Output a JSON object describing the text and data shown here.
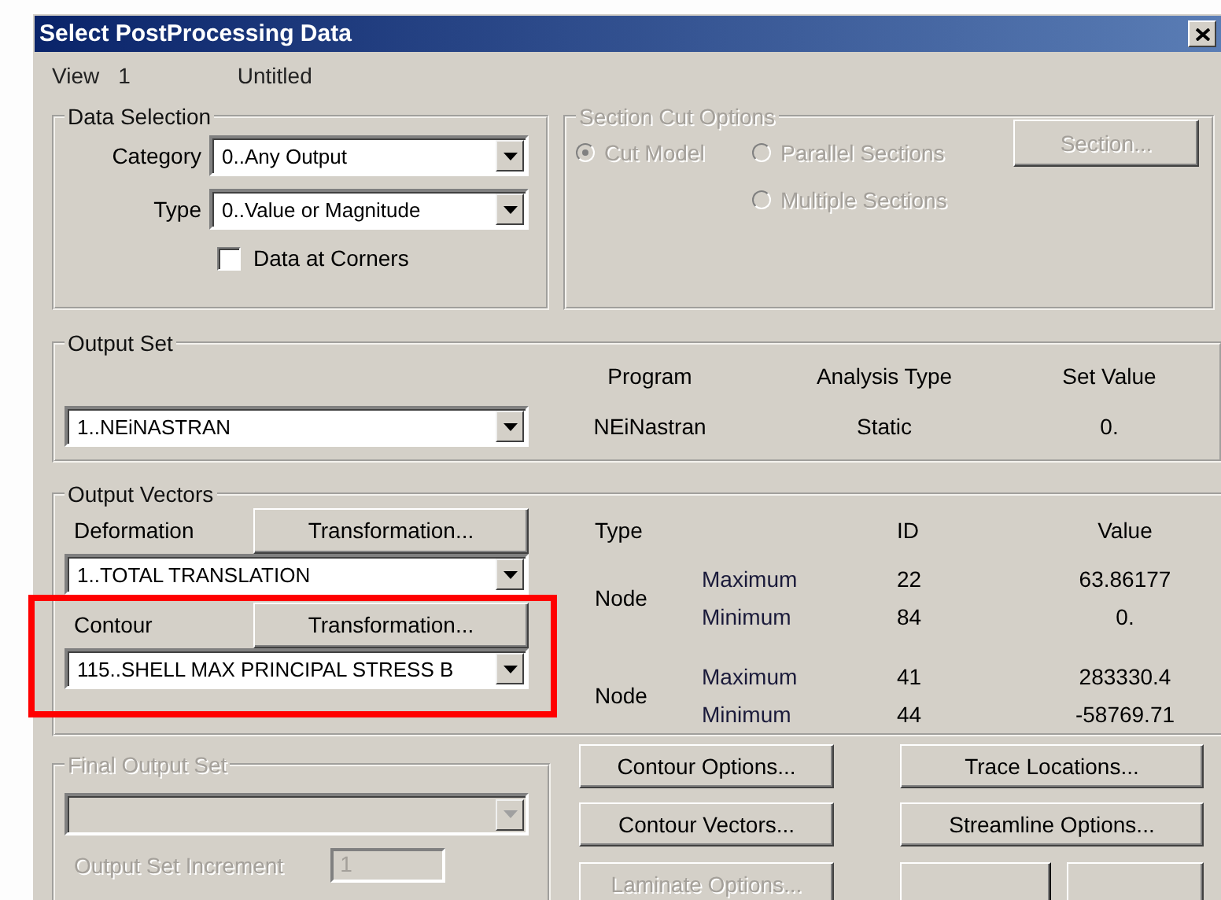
{
  "window": {
    "title": "Select PostProcessing Data"
  },
  "view": {
    "label": "View",
    "number": "1",
    "name": "Untitled"
  },
  "data_selection": {
    "title": "Data Selection",
    "fields": [
      {
        "label": "Category",
        "value": "0..Any Output"
      },
      {
        "label": "Type",
        "value": "0..Value or Magnitude"
      }
    ],
    "data_at_corners": {
      "label": "Data at Corners",
      "checked": false
    }
  },
  "section_cut": {
    "title": "Section Cut Options",
    "disabled": true,
    "options": [
      {
        "label": "Cut Model",
        "selected": true
      },
      {
        "label": "Parallel Sections",
        "selected": false
      },
      {
        "label": "Multiple Sections",
        "selected": false
      }
    ],
    "button": "Section..."
  },
  "output_set": {
    "title": "Output Set",
    "value": "1..NEiNASTRAN",
    "columns": [
      "Program",
      "Analysis Type",
      "Set Value"
    ],
    "values": [
      "NEiNastran",
      "Static",
      "0."
    ]
  },
  "output_vectors": {
    "title": "Output Vectors",
    "columns": [
      "Type",
      "ID",
      "Value"
    ],
    "vectors": [
      {
        "label": "Deformation",
        "button": "Transformation...",
        "value": "1..TOTAL TRANSLATION",
        "type": "Node",
        "highlighted": false,
        "rows": [
          {
            "label": "Maximum",
            "id": "22",
            "value": "63.86177"
          },
          {
            "label": "Minimum",
            "id": "84",
            "value": "0."
          }
        ]
      },
      {
        "label": "Contour",
        "button": "Transformation...",
        "value": "115..SHELL MAX PRINCIPAL STRESS B",
        "type": "Node",
        "highlighted": true,
        "rows": [
          {
            "label": "Maximum",
            "id": "41",
            "value": "283330.4"
          },
          {
            "label": "Minimum",
            "id": "44",
            "value": "-58769.71"
          }
        ]
      }
    ]
  },
  "final_output_set": {
    "title": "Final Output Set",
    "disabled": true,
    "increment_label": "Output Set Increment",
    "increment_value": "1"
  },
  "buttons": [
    {
      "kind": "text",
      "label": "Contour Options...",
      "disabled": false
    },
    {
      "kind": "text",
      "label": "Trace Locations...",
      "disabled": false
    },
    {
      "kind": "text",
      "label": "Contour Vectors...",
      "disabled": false
    },
    {
      "kind": "text",
      "label": "Streamline Options...",
      "disabled": false
    },
    {
      "kind": "text",
      "label": "Laminate Options...",
      "disabled": true
    },
    {
      "kind": "blank"
    },
    {
      "kind": "blank"
    }
  ]
}
